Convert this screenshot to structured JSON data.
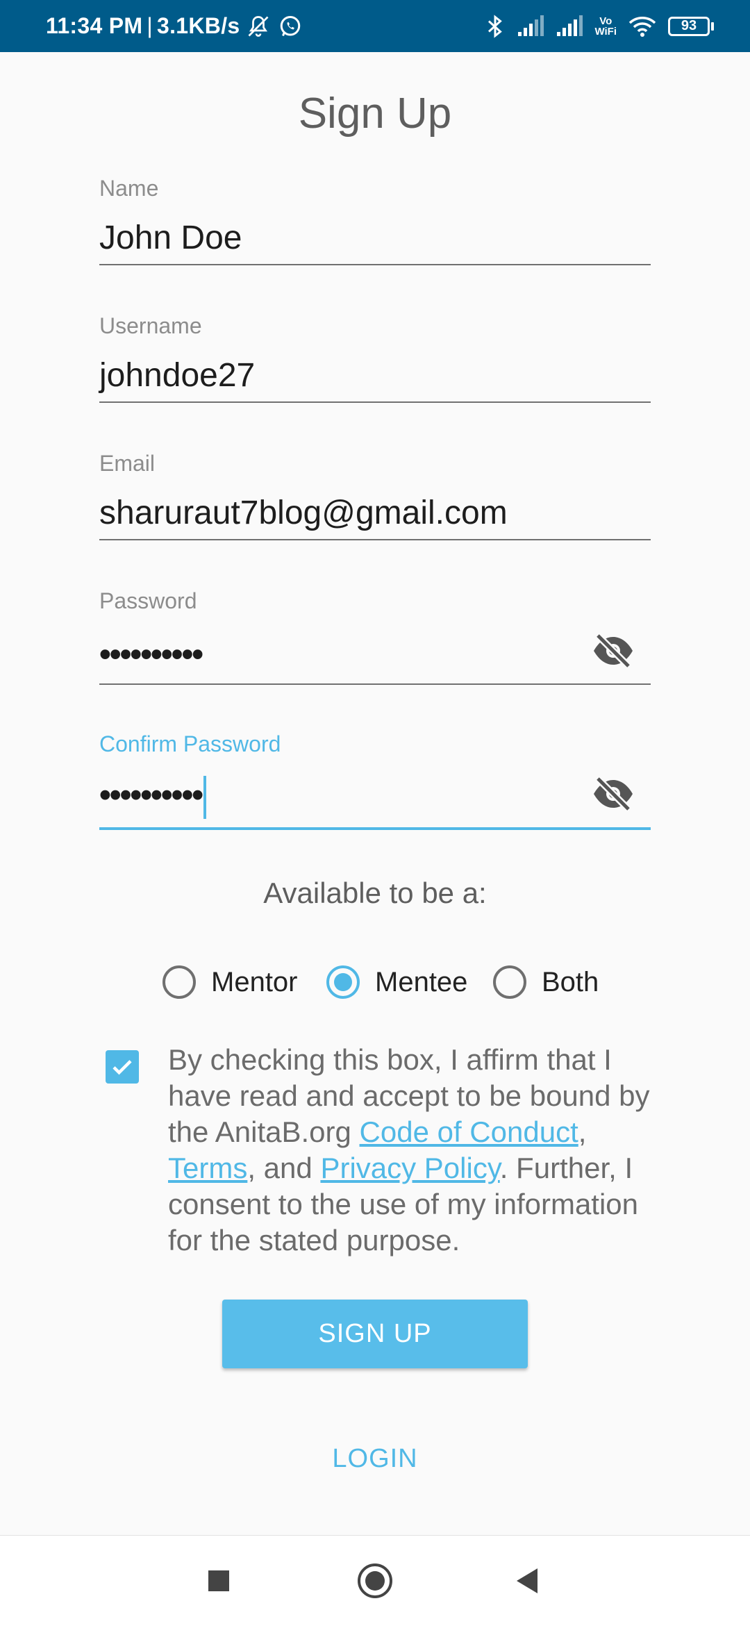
{
  "status_bar": {
    "time": "11:34 PM",
    "separator": "|",
    "speed": "3.1KB/s",
    "vowifi_label_top": "Vo",
    "vowifi_label_bottom": "WiFi",
    "battery": "93",
    "icons": [
      "mute-bell-icon",
      "whatsapp-icon",
      "bluetooth-icon",
      "signal-icon",
      "signal-icon",
      "wifi-icon",
      "battery-icon"
    ]
  },
  "page": {
    "title": "Sign Up"
  },
  "form": {
    "name": {
      "label": "Name",
      "value": "John Doe"
    },
    "username": {
      "label": "Username",
      "value": "johndoe27"
    },
    "email": {
      "label": "Email",
      "value": "sharuraut7blog@gmail.com"
    },
    "password": {
      "label": "Password",
      "value": "••••••••••"
    },
    "confirm_password": {
      "label": "Confirm Password",
      "value": "••••••••••"
    }
  },
  "availability": {
    "label": "Available to be a:",
    "options": [
      {
        "label": "Mentor",
        "selected": false
      },
      {
        "label": "Mentee",
        "selected": true
      },
      {
        "label": "Both",
        "selected": false
      }
    ]
  },
  "consent": {
    "checked": true,
    "text_1": "By checking this box, I affirm that I have read and accept to be bound by the AnitaB.org ",
    "link_code": "Code of Conduct",
    "text_2": ", ",
    "link_terms": "Terms",
    "text_3": ", and ",
    "link_privacy": "Privacy Policy",
    "text_4": ". Further, I consent to the use of my information for the stated purpose."
  },
  "buttons": {
    "signup": "SIGN UP",
    "login": "LOGIN"
  },
  "colors": {
    "accent": "#50b8e6",
    "status_bar": "#005b8a",
    "button": "#58bdea"
  }
}
